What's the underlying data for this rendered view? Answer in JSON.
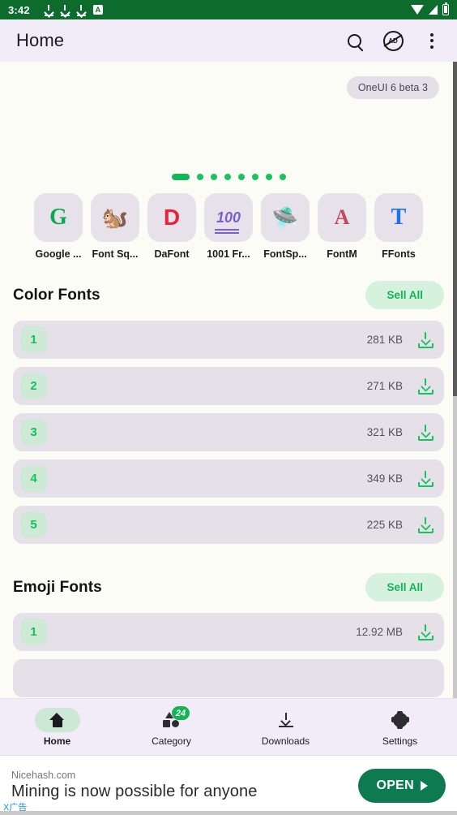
{
  "statusbar": {
    "time": "3:42",
    "left_icons": [
      "download-icon",
      "download-icon",
      "download-icon",
      "a-badge-icon"
    ],
    "right_icons": [
      "wifi-icon",
      "signal-icon",
      "battery-icon"
    ],
    "background": "#0d6b2e",
    "a_badge_label": "A"
  },
  "appbar": {
    "title": "Home",
    "actions": [
      "search-icon",
      "ad-block-icon",
      "overflow-menu-icon"
    ],
    "ad_block_label": "AD",
    "background": "#f1ecf7"
  },
  "beta_chip": {
    "label": "OneUI 6 beta 3"
  },
  "carousel": {
    "total_pages": 8,
    "active_index": 0,
    "active_color": "#13b755",
    "dot_color": "#17c45e"
  },
  "shortcuts": [
    {
      "label": "Google ...",
      "icon": "google-fonts-icon",
      "glyph": "G"
    },
    {
      "label": "Font Sq...",
      "icon": "font-squirrel-icon",
      "glyph": "🐿"
    },
    {
      "label": "DaFont",
      "icon": "dafont-icon",
      "glyph": "D"
    },
    {
      "label": "1001 Fr...",
      "icon": "1001-fonts-icon",
      "glyph": "100"
    },
    {
      "label": "FontSp...",
      "icon": "fontspace-icon",
      "glyph": "🛸"
    },
    {
      "label": "FontM",
      "icon": "fontm-icon",
      "glyph": "A"
    },
    {
      "label": "FFonts",
      "icon": "ffonts-icon",
      "glyph": "T"
    }
  ],
  "sections": [
    {
      "title": "Color Fonts",
      "action_label": "Sell All",
      "rows": [
        {
          "rank": "1",
          "size": "281 KB"
        },
        {
          "rank": "2",
          "size": "271 KB"
        },
        {
          "rank": "3",
          "size": "321 KB"
        },
        {
          "rank": "4",
          "size": "349 KB"
        },
        {
          "rank": "5",
          "size": "225 KB"
        }
      ]
    },
    {
      "title": "Emoji Fonts",
      "action_label": "Sell All",
      "rows": [
        {
          "rank": "1",
          "size": "12.92 MB"
        }
      ]
    }
  ],
  "bottomnav": {
    "items": [
      {
        "label": "Home",
        "icon": "home-icon",
        "active": true,
        "badge": null
      },
      {
        "label": "Category",
        "icon": "category-icon",
        "active": false,
        "badge": "24"
      },
      {
        "label": "Downloads",
        "icon": "download-icon",
        "active": false,
        "badge": null
      },
      {
        "label": "Settings",
        "icon": "gear-icon",
        "active": false,
        "badge": null
      }
    ],
    "badge_color": "#16b356",
    "active_pill_color": "#cde9d5"
  },
  "ad": {
    "source": "Nicehash.com",
    "headline": "Mining is now possible for anyone",
    "button_label": "OPEN",
    "close_label": "X广告",
    "button_color": "#0e7a52"
  },
  "colors": {
    "accent_green": "#16b356",
    "row_background": "#e6e0e9",
    "rank_background": "#cfe9d7",
    "content_background": "#fbfcf5"
  }
}
